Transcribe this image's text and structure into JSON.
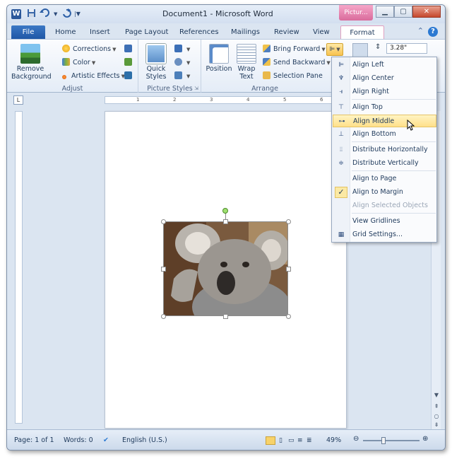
{
  "window": {
    "title": "Document1 - Microsoft Word",
    "context_tab": "Pictur...",
    "app_icon": "W"
  },
  "quick_access": {
    "save": "save-icon",
    "undo": "undo-icon",
    "redo": "redo-icon"
  },
  "tabs": [
    {
      "label": "File"
    },
    {
      "label": "Home"
    },
    {
      "label": "Insert"
    },
    {
      "label": "Page Layout"
    },
    {
      "label": "References"
    },
    {
      "label": "Mailings"
    },
    {
      "label": "Review"
    },
    {
      "label": "View"
    },
    {
      "label": "Format"
    }
  ],
  "ribbon": {
    "adjust": {
      "label": "Adjust",
      "remove_background": "Remove Background",
      "corrections": "Corrections",
      "color": "Color",
      "artistic_effects": "Artistic Effects"
    },
    "picture_styles": {
      "label": "Picture Styles",
      "quick_styles": "Quick Styles"
    },
    "arrange": {
      "label": "Arrange",
      "position": "Position",
      "wrap_text": "Wrap Text",
      "bring_forward": "Bring Forward",
      "send_backward": "Send Backward",
      "selection_pane": "Selection Pane"
    },
    "size_value": "3.28\""
  },
  "menu": {
    "items": [
      {
        "label": "Align Left",
        "icon": "align-left-icon"
      },
      {
        "label": "Align Center",
        "icon": "align-center-icon"
      },
      {
        "label": "Align Right",
        "icon": "align-right-icon"
      },
      {
        "label": "Align Top",
        "icon": "align-top-icon"
      },
      {
        "label": "Align Middle",
        "icon": "align-middle-icon"
      },
      {
        "label": "Align Bottom",
        "icon": "align-bottom-icon"
      },
      {
        "label": "Distribute Horizontally",
        "icon": "distribute-horizontally-icon"
      },
      {
        "label": "Distribute Vertically",
        "icon": "distribute-vertically-icon"
      },
      {
        "label": "Align to Page"
      },
      {
        "label": "Align to Margin",
        "checked": true
      },
      {
        "label": "Align Selected Objects",
        "disabled": true
      },
      {
        "label": "View Gridlines"
      },
      {
        "label": "Grid Settings...",
        "icon": "grid-icon"
      }
    ],
    "highlighted": "Align Middle"
  },
  "ruler": {
    "ticks": [
      "1",
      "2",
      "3",
      "4",
      "5",
      "6"
    ]
  },
  "status": {
    "page": "Page: 1 of 1",
    "words": "Words: 0",
    "language": "English (U.S.)",
    "zoom": "49%"
  }
}
